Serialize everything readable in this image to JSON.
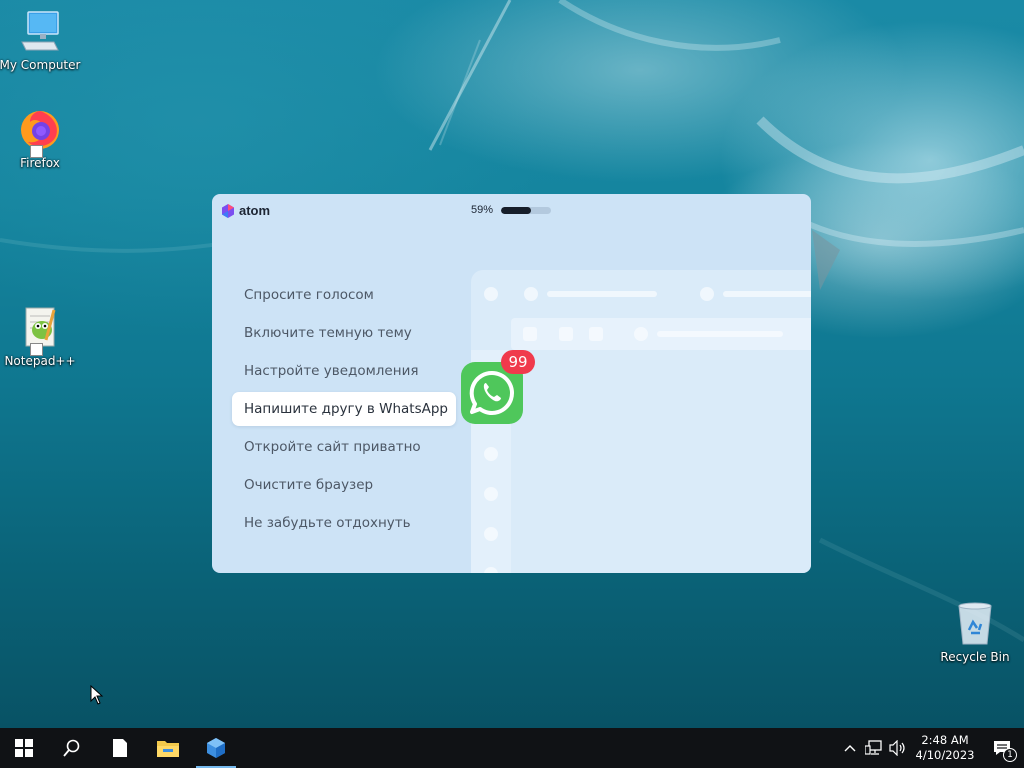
{
  "desktop": {
    "icons": [
      {
        "label": "My Computer",
        "icon": "computer-icon"
      },
      {
        "label": "Firefox",
        "icon": "firefox-icon"
      },
      {
        "label": "Notepad++",
        "icon": "notepad-plus-plus-icon"
      },
      {
        "label": "Recycle Bin",
        "icon": "recycle-bin-icon"
      }
    ]
  },
  "atom_window": {
    "brand": "atom",
    "progress_text": "59%",
    "progress_value": 0.59,
    "tips": [
      "Спросите голосом",
      "Включите темную тему",
      "Настройте уведомления",
      "Напишите другу в WhatsApp",
      "Откройте сайт приватно",
      "Очистите браузер",
      "Не забудьте отдохнуть"
    ],
    "active_tip_index": 3,
    "whatsapp_badge": "99",
    "colors": {
      "panel": "#cde3f6",
      "badge": "#f03a4c",
      "whatsapp": "#4fc75b"
    }
  },
  "taskbar": {
    "buttons": [
      "start-icon",
      "search-icon",
      "file-icon",
      "file-explorer-icon",
      "atom-browser-icon"
    ],
    "clock_time": "2:48 AM",
    "clock_date": "4/10/2023",
    "notification_count": "1"
  }
}
